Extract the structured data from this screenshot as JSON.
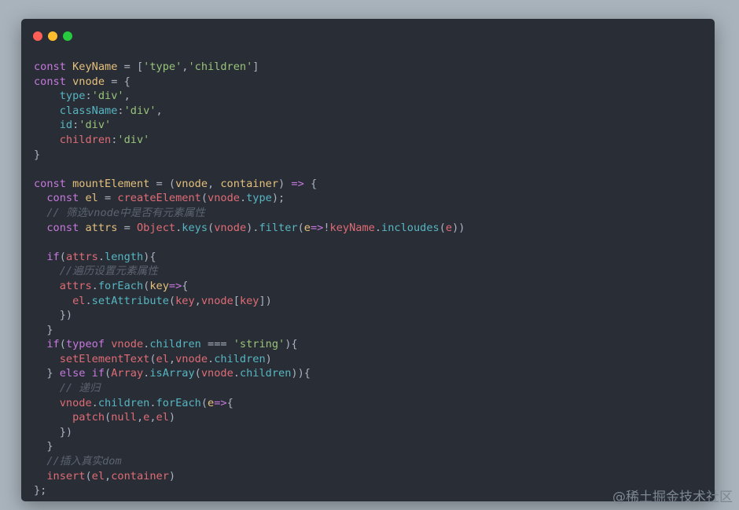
{
  "window": {
    "controls": [
      {
        "name": "close",
        "color": "#ff5f56"
      },
      {
        "name": "minimize",
        "color": "#ffbd2e"
      },
      {
        "name": "maximize",
        "color": "#27c93f"
      }
    ]
  },
  "code": {
    "lines": [
      [
        [
          "keyword",
          "const "
        ],
        [
          "var",
          "KeyName"
        ],
        [
          "punct",
          " = ["
        ],
        [
          "string",
          "'type'"
        ],
        [
          "punct",
          ","
        ],
        [
          "string",
          "'children'"
        ],
        [
          "punct",
          "]"
        ]
      ],
      [
        [
          "keyword",
          "const "
        ],
        [
          "var",
          "vnode"
        ],
        [
          "punct",
          " = {"
        ]
      ],
      [
        [
          "text",
          "    "
        ],
        [
          "prop",
          "type"
        ],
        [
          "punct",
          ":"
        ],
        [
          "string",
          "'div'"
        ],
        [
          "punct",
          ","
        ]
      ],
      [
        [
          "text",
          "    "
        ],
        [
          "prop",
          "className"
        ],
        [
          "punct",
          ":"
        ],
        [
          "string",
          "'div'"
        ],
        [
          "punct",
          ","
        ]
      ],
      [
        [
          "text",
          "    "
        ],
        [
          "prop",
          "id"
        ],
        [
          "punct",
          ":"
        ],
        [
          "string",
          "'div'"
        ]
      ],
      [
        [
          "text",
          "    "
        ],
        [
          "ident",
          "children"
        ],
        [
          "punct",
          ":"
        ],
        [
          "string",
          "'div'"
        ]
      ],
      [
        [
          "punct",
          "}"
        ]
      ],
      [],
      [
        [
          "keyword",
          "const "
        ],
        [
          "var",
          "mountElement"
        ],
        [
          "punct",
          " = ("
        ],
        [
          "param",
          "vnode"
        ],
        [
          "punct",
          ", "
        ],
        [
          "param",
          "container"
        ],
        [
          "punct",
          ") "
        ],
        [
          "keyword",
          "=>"
        ],
        [
          "punct",
          " {"
        ]
      ],
      [
        [
          "text",
          "  "
        ],
        [
          "keyword",
          "const "
        ],
        [
          "var",
          "el"
        ],
        [
          "punct",
          " = "
        ],
        [
          "func",
          "createElement"
        ],
        [
          "punct",
          "("
        ],
        [
          "ident",
          "vnode"
        ],
        [
          "punct",
          "."
        ],
        [
          "prop",
          "type"
        ],
        [
          "punct",
          ");"
        ]
      ],
      [
        [
          "text",
          "  "
        ],
        [
          "comment",
          "// 筛选vnode中是否有元素属性"
        ]
      ],
      [
        [
          "text",
          "  "
        ],
        [
          "keyword",
          "const "
        ],
        [
          "var",
          "attrs"
        ],
        [
          "punct",
          " = "
        ],
        [
          "ident",
          "Object"
        ],
        [
          "punct",
          "."
        ],
        [
          "prop",
          "keys"
        ],
        [
          "punct",
          "("
        ],
        [
          "ident",
          "vnode"
        ],
        [
          "punct",
          ")."
        ],
        [
          "prop",
          "filter"
        ],
        [
          "punct",
          "("
        ],
        [
          "param",
          "e"
        ],
        [
          "keyword",
          "=>"
        ],
        [
          "punct",
          "!"
        ],
        [
          "ident",
          "keyName"
        ],
        [
          "punct",
          "."
        ],
        [
          "prop",
          "incloudes"
        ],
        [
          "punct",
          "("
        ],
        [
          "ident",
          "e"
        ],
        [
          "punct",
          "))"
        ]
      ],
      [],
      [
        [
          "text",
          "  "
        ],
        [
          "keyword",
          "if"
        ],
        [
          "punct",
          "("
        ],
        [
          "ident",
          "attrs"
        ],
        [
          "punct",
          "."
        ],
        [
          "prop",
          "length"
        ],
        [
          "punct",
          "){"
        ]
      ],
      [
        [
          "text",
          "    "
        ],
        [
          "comment",
          "//遍历设置元素属性"
        ]
      ],
      [
        [
          "text",
          "    "
        ],
        [
          "ident",
          "attrs"
        ],
        [
          "punct",
          "."
        ],
        [
          "prop",
          "forEach"
        ],
        [
          "punct",
          "("
        ],
        [
          "param",
          "key"
        ],
        [
          "keyword",
          "=>"
        ],
        [
          "punct",
          "{"
        ]
      ],
      [
        [
          "text",
          "      "
        ],
        [
          "ident",
          "el"
        ],
        [
          "punct",
          "."
        ],
        [
          "prop",
          "setAttribute"
        ],
        [
          "punct",
          "("
        ],
        [
          "ident",
          "key"
        ],
        [
          "punct",
          ","
        ],
        [
          "ident",
          "vnode"
        ],
        [
          "punct",
          "["
        ],
        [
          "ident",
          "key"
        ],
        [
          "punct",
          "])"
        ]
      ],
      [
        [
          "text",
          "    "
        ],
        [
          "punct",
          "})"
        ]
      ],
      [
        [
          "text",
          "  "
        ],
        [
          "punct",
          "}"
        ]
      ],
      [
        [
          "text",
          "  "
        ],
        [
          "keyword",
          "if"
        ],
        [
          "punct",
          "("
        ],
        [
          "keyword",
          "typeof "
        ],
        [
          "ident",
          "vnode"
        ],
        [
          "punct",
          "."
        ],
        [
          "prop",
          "children"
        ],
        [
          "punct",
          " === "
        ],
        [
          "string",
          "'string'"
        ],
        [
          "punct",
          "){"
        ]
      ],
      [
        [
          "text",
          "    "
        ],
        [
          "func",
          "setElementText"
        ],
        [
          "punct",
          "("
        ],
        [
          "ident",
          "el"
        ],
        [
          "punct",
          ","
        ],
        [
          "ident",
          "vnode"
        ],
        [
          "punct",
          "."
        ],
        [
          "prop",
          "children"
        ],
        [
          "punct",
          ")"
        ]
      ],
      [
        [
          "text",
          "  "
        ],
        [
          "punct",
          "} "
        ],
        [
          "keyword",
          "else if"
        ],
        [
          "punct",
          "("
        ],
        [
          "ident",
          "Array"
        ],
        [
          "punct",
          "."
        ],
        [
          "prop",
          "isArray"
        ],
        [
          "punct",
          "("
        ],
        [
          "ident",
          "vnode"
        ],
        [
          "punct",
          "."
        ],
        [
          "prop",
          "children"
        ],
        [
          "punct",
          "))"
        ],
        [
          "punct",
          "{"
        ]
      ],
      [
        [
          "text",
          "    "
        ],
        [
          "comment",
          "// 递归"
        ]
      ],
      [
        [
          "text",
          "    "
        ],
        [
          "ident",
          "vnode"
        ],
        [
          "punct",
          "."
        ],
        [
          "prop",
          "children"
        ],
        [
          "punct",
          "."
        ],
        [
          "prop",
          "forEach"
        ],
        [
          "punct",
          "("
        ],
        [
          "param",
          "e"
        ],
        [
          "keyword",
          "=>"
        ],
        [
          "punct",
          "{"
        ]
      ],
      [
        [
          "text",
          "      "
        ],
        [
          "func",
          "patch"
        ],
        [
          "punct",
          "("
        ],
        [
          "ident",
          "null"
        ],
        [
          "punct",
          ","
        ],
        [
          "ident",
          "e"
        ],
        [
          "punct",
          ","
        ],
        [
          "ident",
          "el"
        ],
        [
          "punct",
          ")"
        ]
      ],
      [
        [
          "text",
          "    "
        ],
        [
          "punct",
          "})"
        ]
      ],
      [
        [
          "text",
          "  "
        ],
        [
          "punct",
          "}"
        ]
      ],
      [
        [
          "text",
          "  "
        ],
        [
          "comment",
          "//插入真实dom"
        ]
      ],
      [
        [
          "text",
          "  "
        ],
        [
          "func",
          "insert"
        ],
        [
          "punct",
          "("
        ],
        [
          "ident",
          "el"
        ],
        [
          "punct",
          ","
        ],
        [
          "ident",
          "container"
        ],
        [
          "punct",
          ")"
        ]
      ],
      [
        [
          "punct",
          "};"
        ]
      ]
    ]
  },
  "watermark": {
    "text": "@稀土掘金技术社区"
  }
}
